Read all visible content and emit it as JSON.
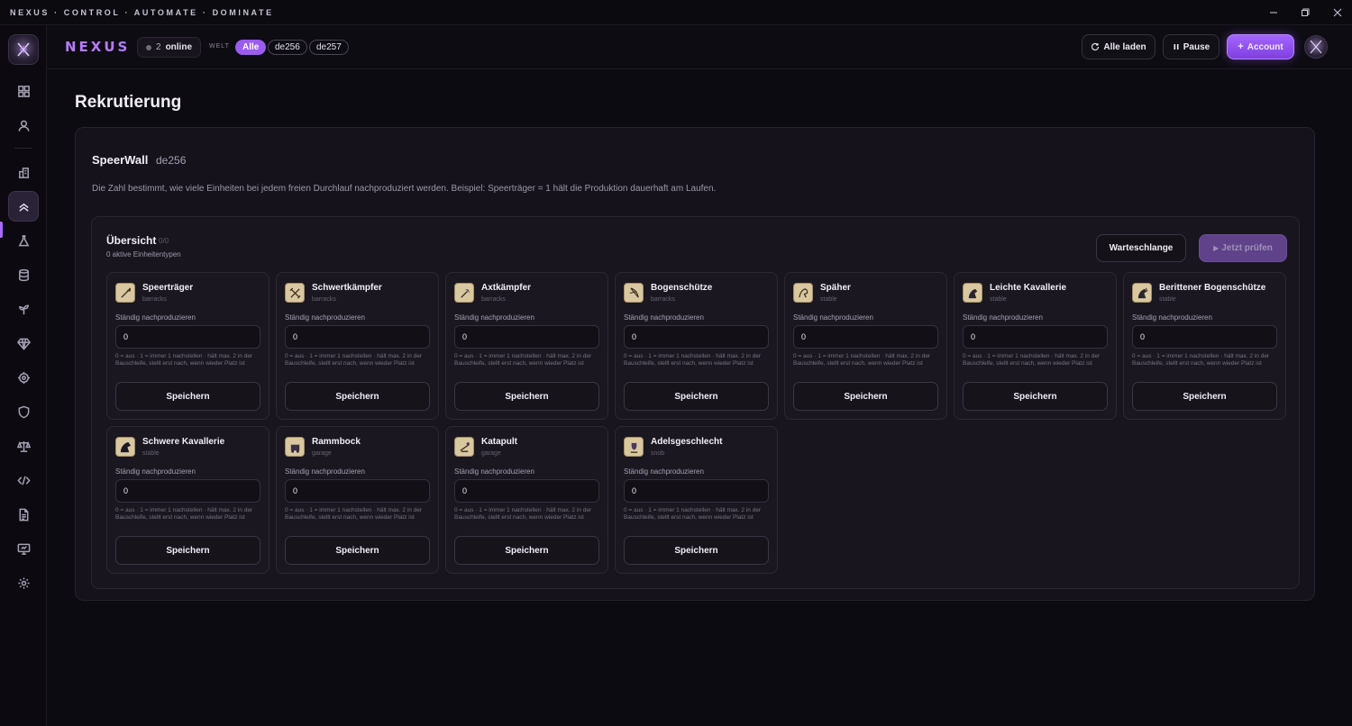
{
  "window": {
    "title": "NEXUS · CONTROL · AUTOMATE · DOMINATE"
  },
  "header": {
    "brand": "NEXUS",
    "online_count": "2",
    "online_label": "online",
    "world_label": "WELT",
    "world_chips": [
      "Alle",
      "de256",
      "de257"
    ],
    "world_selected": "Alle",
    "reload_label": "Alle laden",
    "pause_label": "Pause",
    "account_label": "Account"
  },
  "sidebar": {
    "items": [
      "dashboard-icon",
      "user-icon",
      "buildings-icon",
      "recruit-icon",
      "flask-icon",
      "database-icon",
      "sprout-icon",
      "gem-icon",
      "target-icon",
      "shield-icon",
      "scales-icon",
      "code-icon",
      "document-icon",
      "monitor-icon",
      "settings-icon"
    ],
    "active": "recruit-icon"
  },
  "page": {
    "title": "Rekrutierung"
  },
  "panel": {
    "name": "SpeerWall",
    "world": "de256",
    "description": "Die Zahl bestimmt, wie viele Einheiten bei jedem freien Durchlauf nachproduziert werden. Beispiel: Speerträger = 1 hält die Produktion dauerhaft am Laufen."
  },
  "overview": {
    "title": "Übersicht",
    "count": "0/0",
    "subtitle": "0 aktive Einheitentypen",
    "queue_label": "Warteschlange",
    "check_label": "Jetzt prüfen"
  },
  "units": [
    {
      "name": "Speerträger",
      "building": "barracks",
      "icon": "spear-icon",
      "label": "Ständig nachproduzieren",
      "value": "0",
      "help": "0 = aus · 1 = immer 1 nachstellen · hält max. 2 in der Bauschleife, stellt erst nach, wenn wieder Platz ist",
      "save": "Speichern"
    },
    {
      "name": "Schwertkämpfer",
      "building": "barracks",
      "icon": "sword-icon",
      "label": "Ständig nachproduzieren",
      "value": "0",
      "help": "0 = aus · 1 = immer 1 nachstellen · hält max. 2 in der Bauschleife, stellt erst nach, wenn wieder Platz ist",
      "save": "Speichern"
    },
    {
      "name": "Axtkämpfer",
      "building": "barracks",
      "icon": "axe-icon",
      "label": "Ständig nachproduzieren",
      "value": "0",
      "help": "0 = aus · 1 = immer 1 nachstellen · hält max. 2 in der Bauschleife, stellt erst nach, wenn wieder Platz ist",
      "save": "Speichern"
    },
    {
      "name": "Bogenschütze",
      "building": "barracks",
      "icon": "bow-icon",
      "label": "Ständig nachproduzieren",
      "value": "0",
      "help": "0 = aus · 1 = immer 1 nachstellen · hält max. 2 in der Bauschleife, stellt erst nach, wenn wieder Platz ist",
      "save": "Speichern"
    },
    {
      "name": "Späher",
      "building": "stable",
      "icon": "scout-icon",
      "label": "Ständig nachproduzieren",
      "value": "0",
      "help": "0 = aus · 1 = immer 1 nachstellen · hält max. 2 in der Bauschleife, stellt erst nach, wenn wieder Platz ist",
      "save": "Speichern"
    },
    {
      "name": "Leichte Kavallerie",
      "building": "stable",
      "icon": "light-cavalry-icon",
      "label": "Ständig nachproduzieren",
      "value": "0",
      "help": "0 = aus · 1 = immer 1 nachstellen · hält max. 2 in der Bauschleife, stellt erst nach, wenn wieder Platz ist",
      "save": "Speichern"
    },
    {
      "name": "Berittener Bogenschütze",
      "building": "stable",
      "icon": "mounted-archer-icon",
      "label": "Ständig nachproduzieren",
      "value": "0",
      "help": "0 = aus · 1 = immer 1 nachstellen · hält max. 2 in der Bauschleife, stellt erst nach, wenn wieder Platz ist",
      "save": "Speichern"
    },
    {
      "name": "Schwere Kavallerie",
      "building": "stable",
      "icon": "heavy-cavalry-icon",
      "label": "Ständig nachproduzieren",
      "value": "0",
      "help": "0 = aus · 1 = immer 1 nachstellen · hält max. 2 in der Bauschleife, stellt erst nach, wenn wieder Platz ist",
      "save": "Speichern"
    },
    {
      "name": "Rammbock",
      "building": "garage",
      "icon": "ram-icon",
      "label": "Ständig nachproduzieren",
      "value": "0",
      "help": "0 = aus · 1 = immer 1 nachstellen · hält max. 2 in der Bauschleife, stellt erst nach, wenn wieder Platz ist",
      "save": "Speichern"
    },
    {
      "name": "Katapult",
      "building": "garage",
      "icon": "catapult-icon",
      "label": "Ständig nachproduzieren",
      "value": "0",
      "help": "0 = aus · 1 = immer 1 nachstellen · hält max. 2 in der Bauschleife, stellt erst nach, wenn wieder Platz ist",
      "save": "Speichern"
    },
    {
      "name": "Adelsgeschlecht",
      "building": "snob",
      "icon": "noble-icon",
      "label": "Ständig nachproduzieren",
      "value": "0",
      "help": "0 = aus · 1 = immer 1 nachstellen · hält max. 2 in der Bauschleife, stellt erst nach, wenn wieder Platz ist",
      "save": "Speichern"
    }
  ],
  "colors": {
    "accent": "#9b5cf0",
    "background": "#0d0b12",
    "card": "#1b1721",
    "unit_icon_bg": "#d9c7a0"
  }
}
